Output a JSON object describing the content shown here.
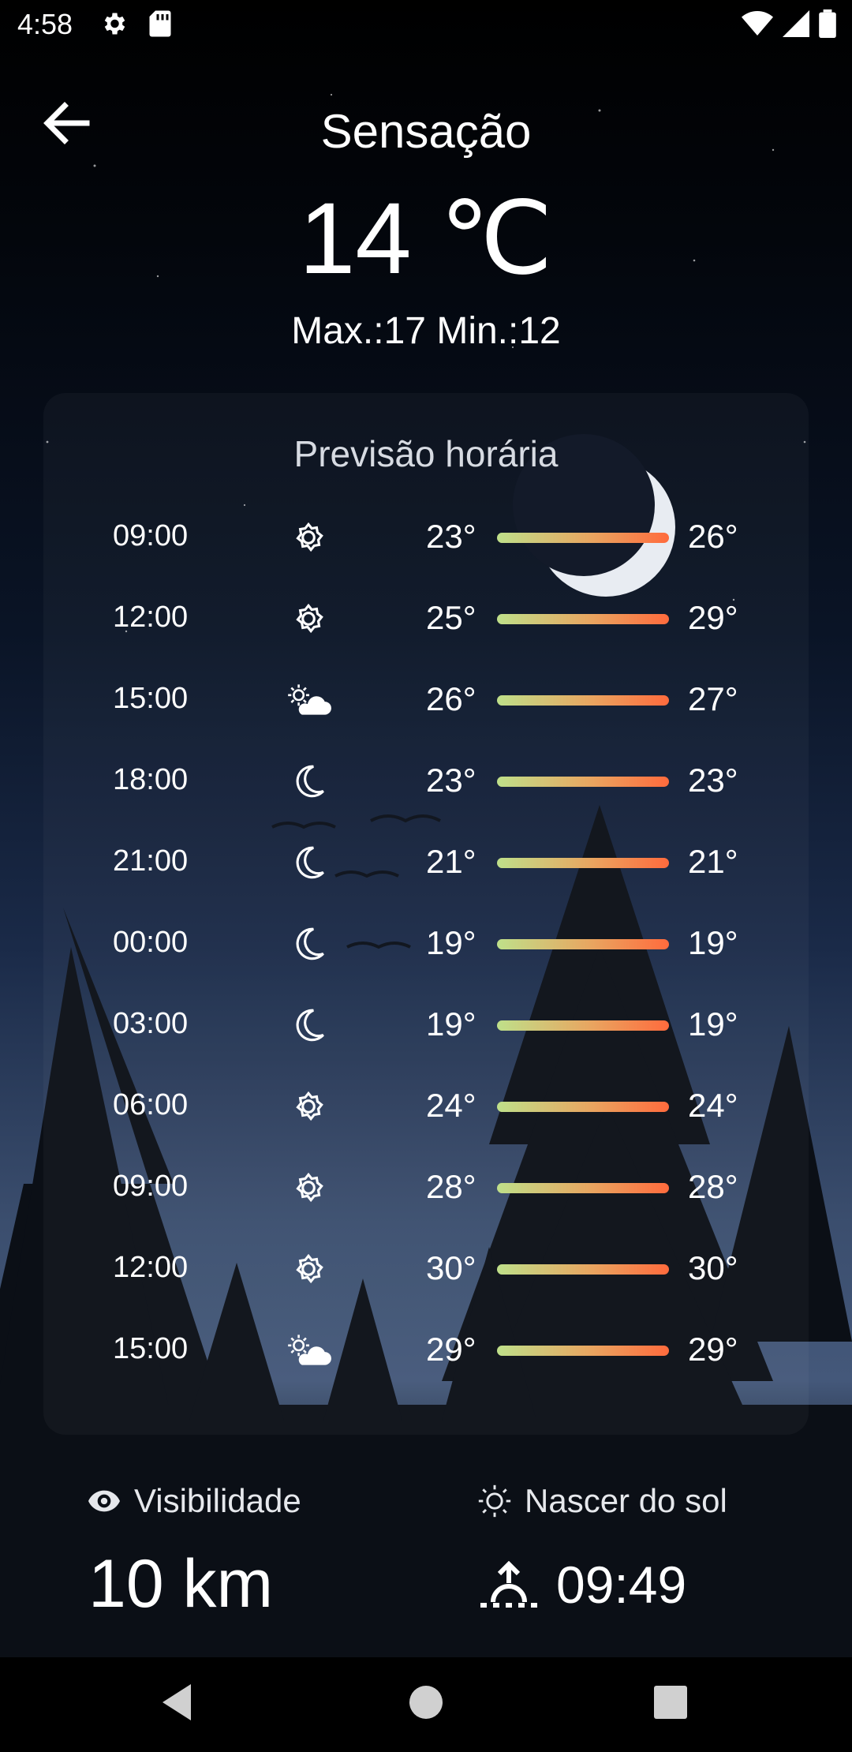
{
  "status": {
    "time": "4:58"
  },
  "header": {
    "title": "Sensação",
    "temperature": "14 ℃",
    "max_min": "Max.:17 Min.:12"
  },
  "hourly": {
    "title": "Previsão horária",
    "rows": [
      {
        "time": "09:00",
        "icon": "sun-icon",
        "low": "23°",
        "high": "26°"
      },
      {
        "time": "12:00",
        "icon": "sun-icon",
        "low": "25°",
        "high": "29°"
      },
      {
        "time": "15:00",
        "icon": "partly-cloudy-icon",
        "low": "26°",
        "high": "27°"
      },
      {
        "time": "18:00",
        "icon": "moon-icon",
        "low": "23°",
        "high": "23°"
      },
      {
        "time": "21:00",
        "icon": "moon-icon",
        "low": "21°",
        "high": "21°"
      },
      {
        "time": "00:00",
        "icon": "moon-icon",
        "low": "19°",
        "high": "19°"
      },
      {
        "time": "03:00",
        "icon": "moon-icon",
        "low": "19°",
        "high": "19°"
      },
      {
        "time": "06:00",
        "icon": "sun-icon",
        "low": "24°",
        "high": "24°"
      },
      {
        "time": "09:00",
        "icon": "sun-icon",
        "low": "28°",
        "high": "28°"
      },
      {
        "time": "12:00",
        "icon": "sun-icon",
        "low": "30°",
        "high": "30°"
      },
      {
        "time": "15:00",
        "icon": "partly-cloudy-icon",
        "low": "29°",
        "high": "29°"
      }
    ]
  },
  "visibility": {
    "label": "Visibilidade",
    "value": "10 km",
    "icon": "eye-icon"
  },
  "sunrise": {
    "label": "Nascer do sol",
    "value": "09:49",
    "icon": "sun-outline-icon"
  },
  "colors": {
    "bar_start": "#bfe08a",
    "bar_mid": "#e9a560",
    "bar_end": "#ff6b3d"
  }
}
